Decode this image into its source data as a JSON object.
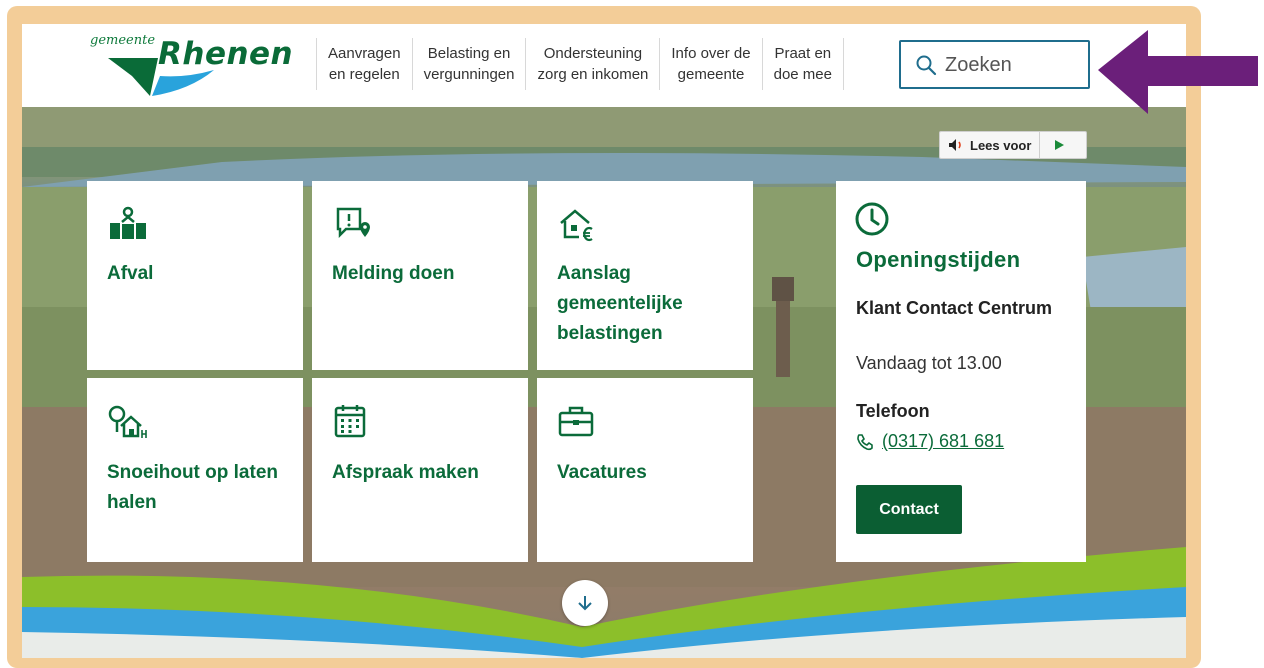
{
  "logo": {
    "small": "gemeente",
    "big": "Rhenen"
  },
  "nav": [
    {
      "label": "Aanvragen\nen regelen"
    },
    {
      "label": "Belasting en\nvergunningen"
    },
    {
      "label": "Ondersteuning\nzorg en inkomen"
    },
    {
      "label": "Info over de\ngemeente"
    },
    {
      "label": "Praat en\ndoe mee"
    }
  ],
  "search": {
    "placeholder": "Zoeken",
    "icon": "search-icon"
  },
  "readspeaker": {
    "label": "Lees voor",
    "icons": [
      "speaker-icon",
      "play-icon"
    ]
  },
  "tiles": [
    {
      "title": "Afval",
      "icon": "waste-bins-icon"
    },
    {
      "title": "Melding doen",
      "icon": "report-location-icon"
    },
    {
      "title": "Aanslag gemeentelijke belastingen",
      "icon": "house-euro-icon"
    },
    {
      "title": "Snoeihout op laten halen",
      "icon": "tree-house-icon"
    },
    {
      "title": "Afspraak maken",
      "icon": "calendar-icon"
    },
    {
      "title": "Vacatures",
      "icon": "briefcase-icon"
    }
  ],
  "hours": {
    "title": "Openingstijden",
    "subtitle": "Klant Contact Centrum",
    "today": "Vandaag tot 13.00",
    "phone_label": "Telefoon",
    "phone": "(0317) 681 681",
    "contact_button": "Contact",
    "icons": [
      "clock-icon",
      "phone-icon"
    ]
  },
  "scroll_icon": "arrow-down-icon",
  "colors": {
    "brand_green": "#0b6b3a",
    "search_border": "#1f6d8d",
    "frame": "#f3cd98",
    "annotation": "#6b1f7a",
    "wave_blue": "#3aa3dc",
    "wave_green": "#8cbf2a"
  }
}
